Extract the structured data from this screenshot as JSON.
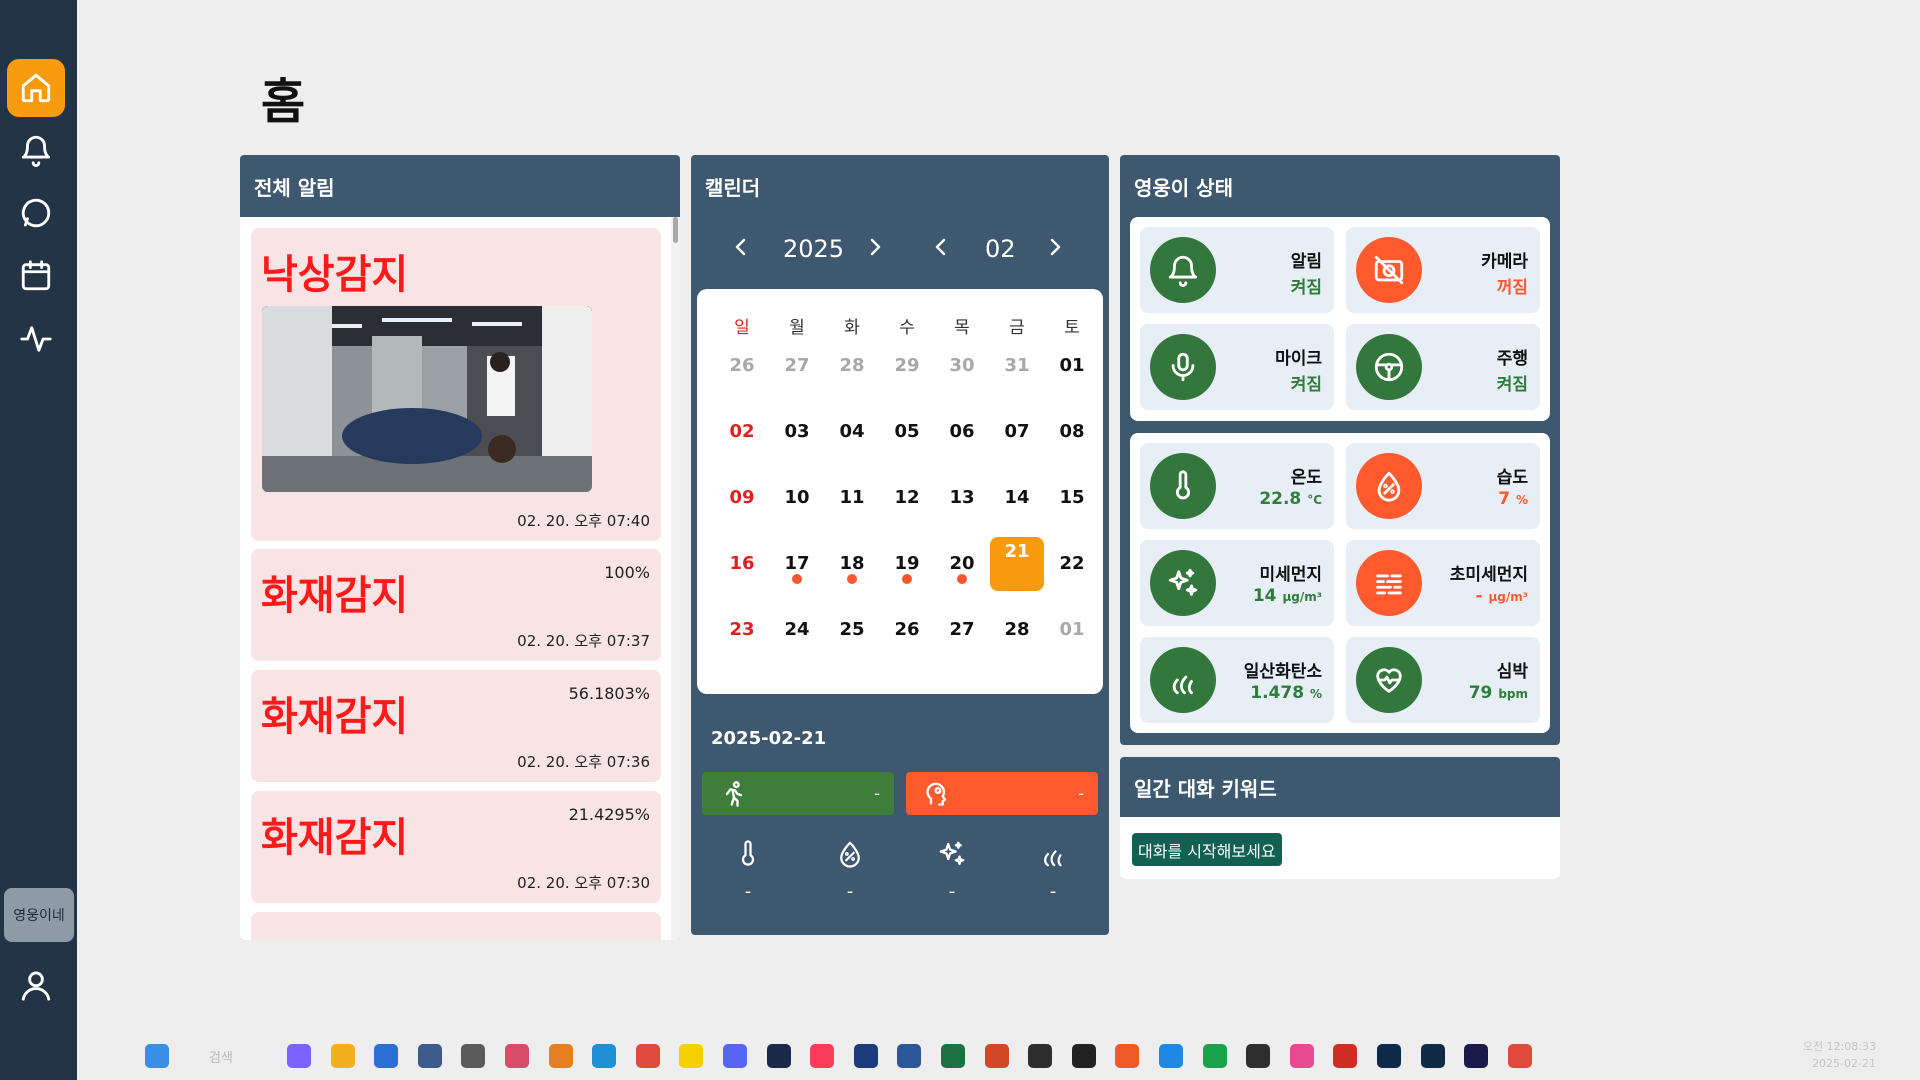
{
  "sidebar": {
    "items": [
      {
        "name": "home",
        "icon": "home-icon"
      },
      {
        "name": "alerts",
        "icon": "bell-icon"
      },
      {
        "name": "chat",
        "icon": "chat-bubble-icon"
      },
      {
        "name": "calendar",
        "icon": "calendar-icon"
      },
      {
        "name": "activity",
        "icon": "pulse-icon"
      }
    ],
    "family_label": "영웅이네",
    "profile_icon": "user-icon",
    "active_color": "#f79a0e"
  },
  "page_title": "홈",
  "alerts": {
    "title": "전체 알림",
    "items": [
      {
        "title": "낙상감지",
        "time": "02. 20. 오후 07:40",
        "has_image": true
      },
      {
        "title": "화재감지",
        "percent": "100%",
        "time": "02. 20. 오후 07:37"
      },
      {
        "title": "화재감지",
        "percent": "56.1803%",
        "time": "02. 20. 오후 07:36"
      },
      {
        "title": "화재감지",
        "percent": "21.4295%",
        "time": "02. 20. 오후 07:30"
      }
    ]
  },
  "calendar": {
    "title": "캘린더",
    "year": "2025",
    "month": "02",
    "weekdays": [
      "일",
      "월",
      "화",
      "수",
      "목",
      "금",
      "토"
    ],
    "weeks": [
      [
        "26",
        "27",
        "28",
        "29",
        "30",
        "31",
        "01"
      ],
      [
        "02",
        "03",
        "04",
        "05",
        "06",
        "07",
        "08"
      ],
      [
        "09",
        "10",
        "11",
        "12",
        "13",
        "14",
        "15"
      ],
      [
        "16",
        "17",
        "18",
        "19",
        "20",
        "21",
        "22"
      ],
      [
        "23",
        "24",
        "25",
        "26",
        "27",
        "28",
        "01"
      ]
    ],
    "selected_day": "21",
    "event_days": [
      "17",
      "18",
      "19",
      "20"
    ],
    "selected_date": "2025-02-21",
    "activity": {
      "value": "-",
      "icon": "running-person-icon",
      "color": "#3f7d3b"
    },
    "mood": {
      "value": "-",
      "icon": "head-icon",
      "color": "#ff5a2e"
    },
    "env": [
      {
        "icon": "thermometer-icon",
        "value": "-"
      },
      {
        "icon": "humidity-icon",
        "value": "-"
      },
      {
        "icon": "sparkle-icon",
        "value": "-"
      },
      {
        "icon": "flame-icon",
        "value": "-"
      }
    ]
  },
  "status": {
    "title": "영웅이 상태",
    "devices": [
      {
        "label": "알림",
        "value": "켜짐",
        "icon": "bell-icon",
        "state": "on"
      },
      {
        "label": "카메라",
        "value": "꺼짐",
        "icon": "camera-off-icon",
        "state": "off"
      },
      {
        "label": "마이크",
        "value": "켜짐",
        "icon": "microphone-icon",
        "state": "on"
      },
      {
        "label": "주행",
        "value": "켜짐",
        "icon": "steering-wheel-icon",
        "state": "on"
      }
    ],
    "sensors": [
      {
        "label": "온도",
        "value": "22.8",
        "unit": "°C",
        "icon": "thermometer-icon",
        "state": "green"
      },
      {
        "label": "습도",
        "value": "7",
        "unit": "%",
        "icon": "humidity-icon",
        "state": "orange"
      },
      {
        "label": "미세먼지",
        "value": "14",
        "unit": "μg/m³",
        "icon": "sparkle-icon",
        "state": "green"
      },
      {
        "label": "초미세먼지",
        "value": "-",
        "unit": "μg/m³",
        "icon": "haze-icon",
        "state": "orange"
      },
      {
        "label": "일산화탄소",
        "value": "1.478",
        "unit": "%",
        "icon": "flame-icon",
        "state": "green"
      },
      {
        "label": "심박",
        "value": "79",
        "unit": "bpm",
        "icon": "heartbeat-icon",
        "state": "green"
      }
    ],
    "green": "#33773d",
    "orange": "#ff5a2e"
  },
  "keywords": {
    "title": "일간 대화 키워드",
    "empty_label": "대화를 시작해보세요"
  },
  "taskbar": {
    "search_placeholder": "검색",
    "time": "오전 12:08:33",
    "date": "2025-02-21"
  }
}
